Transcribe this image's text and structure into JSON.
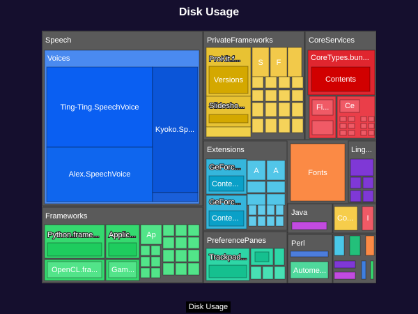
{
  "title": "Disk Usage",
  "footer_label": "Disk Usage",
  "colors": {
    "background": "#150f2e",
    "frame": "#555555",
    "speech": "#2f6fe6",
    "private_frameworks": "#e8c233",
    "core_services": "#e0262f",
    "extensions": "#35b6dc",
    "fonts": "#fb8a45",
    "lingua": "#7f38d6",
    "frameworks": "#35d96f",
    "preference_panes": "#2ed6a6"
  },
  "chart_data": {
    "type": "treemap",
    "title": "Disk Usage",
    "groups": [
      {
        "name": "Speech",
        "label": "Speech",
        "children": [
          {
            "name": "Voices",
            "label": "Voices",
            "children": [
              {
                "name": "Ting-Ting.SpeechVoice",
                "label": "Ting-Ting.SpeechVoice"
              },
              {
                "name": "Alex.SpeechVoice",
                "label": "Alex.SpeechVoice"
              },
              {
                "name": "Kyoko.SpeechVoice",
                "label": "Kyoko.Sp..."
              }
            ]
          }
        ]
      },
      {
        "name": "PrivateFrameworks",
        "label": "PrivateFrameworks",
        "children": [
          {
            "name": "ProKit.framework",
            "label": "ProKit.f...",
            "children": [
              {
                "name": "Versions",
                "label": "Versions"
              }
            ]
          },
          {
            "name": "SlideshowKit",
            "label": "Slideshо..."
          },
          {
            "name": "S",
            "label": "S"
          },
          {
            "name": "F",
            "label": "F"
          }
        ]
      },
      {
        "name": "CoreServices",
        "label": "CoreServices",
        "children": [
          {
            "name": "CoreTypes.bundle",
            "label": "CoreTypes.bun...",
            "children": [
              {
                "name": "Contents",
                "label": "Contents"
              }
            ]
          },
          {
            "name": "Fi",
            "label": "Fi..."
          },
          {
            "name": "Ce",
            "label": "Ce"
          }
        ]
      },
      {
        "name": "Extensions",
        "label": "Extensions",
        "children": [
          {
            "name": "GeForce A",
            "label": "GeForc...",
            "children": [
              {
                "name": "Contents",
                "label": "Conte..."
              }
            ]
          },
          {
            "name": "GeForce B",
            "label": "GeForc...",
            "children": [
              {
                "name": "Contents",
                "label": "Conte..."
              }
            ]
          },
          {
            "name": "A1",
            "label": "A"
          },
          {
            "name": "A2",
            "label": "A"
          }
        ]
      },
      {
        "name": "Fonts",
        "label": "Fonts"
      },
      {
        "name": "Lingua",
        "label": "Ling..."
      },
      {
        "name": "Java",
        "label": "Java"
      },
      {
        "name": "Perl",
        "label": "Perl",
        "children": [
          {
            "name": "Automator",
            "label": "Autome..."
          }
        ]
      },
      {
        "name": "Frameworks",
        "label": "Frameworks",
        "children": [
          {
            "name": "Python.framework",
            "label": "Python.frame..."
          },
          {
            "name": "OpenCL.framework",
            "label": "OpenCL.fra..."
          },
          {
            "name": "AppleScript",
            "label": "Applic..."
          },
          {
            "name": "GameKit",
            "label": "Gam..."
          },
          {
            "name": "Ap",
            "label": "Ap"
          }
        ]
      },
      {
        "name": "PreferencePanes",
        "label": "PreferencePanes",
        "children": [
          {
            "name": "Trackpad",
            "label": "Trackpad..."
          }
        ]
      },
      {
        "name": "Co",
        "label": "Co..."
      },
      {
        "name": "I",
        "label": "I"
      }
    ]
  }
}
